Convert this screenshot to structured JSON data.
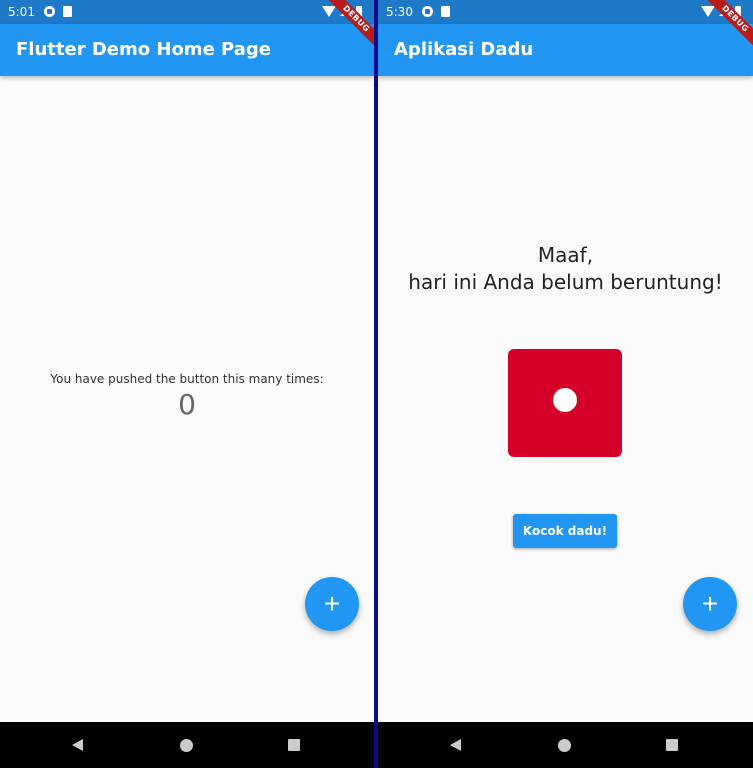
{
  "left_screen": {
    "status_time": "5:01",
    "app_title": "Flutter Demo Home Page",
    "debug_label": "DEBUG",
    "counter_caption": "You have pushed the button this many times:",
    "counter_value": "0",
    "fab_label": "+",
    "fab_icon": "plus-icon"
  },
  "right_screen": {
    "status_time": "5:30",
    "app_title": "Aplikasi Dadu",
    "debug_label": "DEBUG",
    "message_line1": "Maaf,",
    "message_line2": "hari ini Anda belum beruntung!",
    "dice_value": 1,
    "roll_button_label": "Kocok dadu!",
    "fab_label": "+",
    "fab_icon": "plus-icon"
  },
  "colors": {
    "app_bar": "#2196f3",
    "status_bar": "#1e7ac8",
    "dice": "#d50027",
    "divider": "#0a0a8a"
  },
  "nav_icons": [
    "back-icon",
    "home-icon",
    "recents-icon"
  ]
}
